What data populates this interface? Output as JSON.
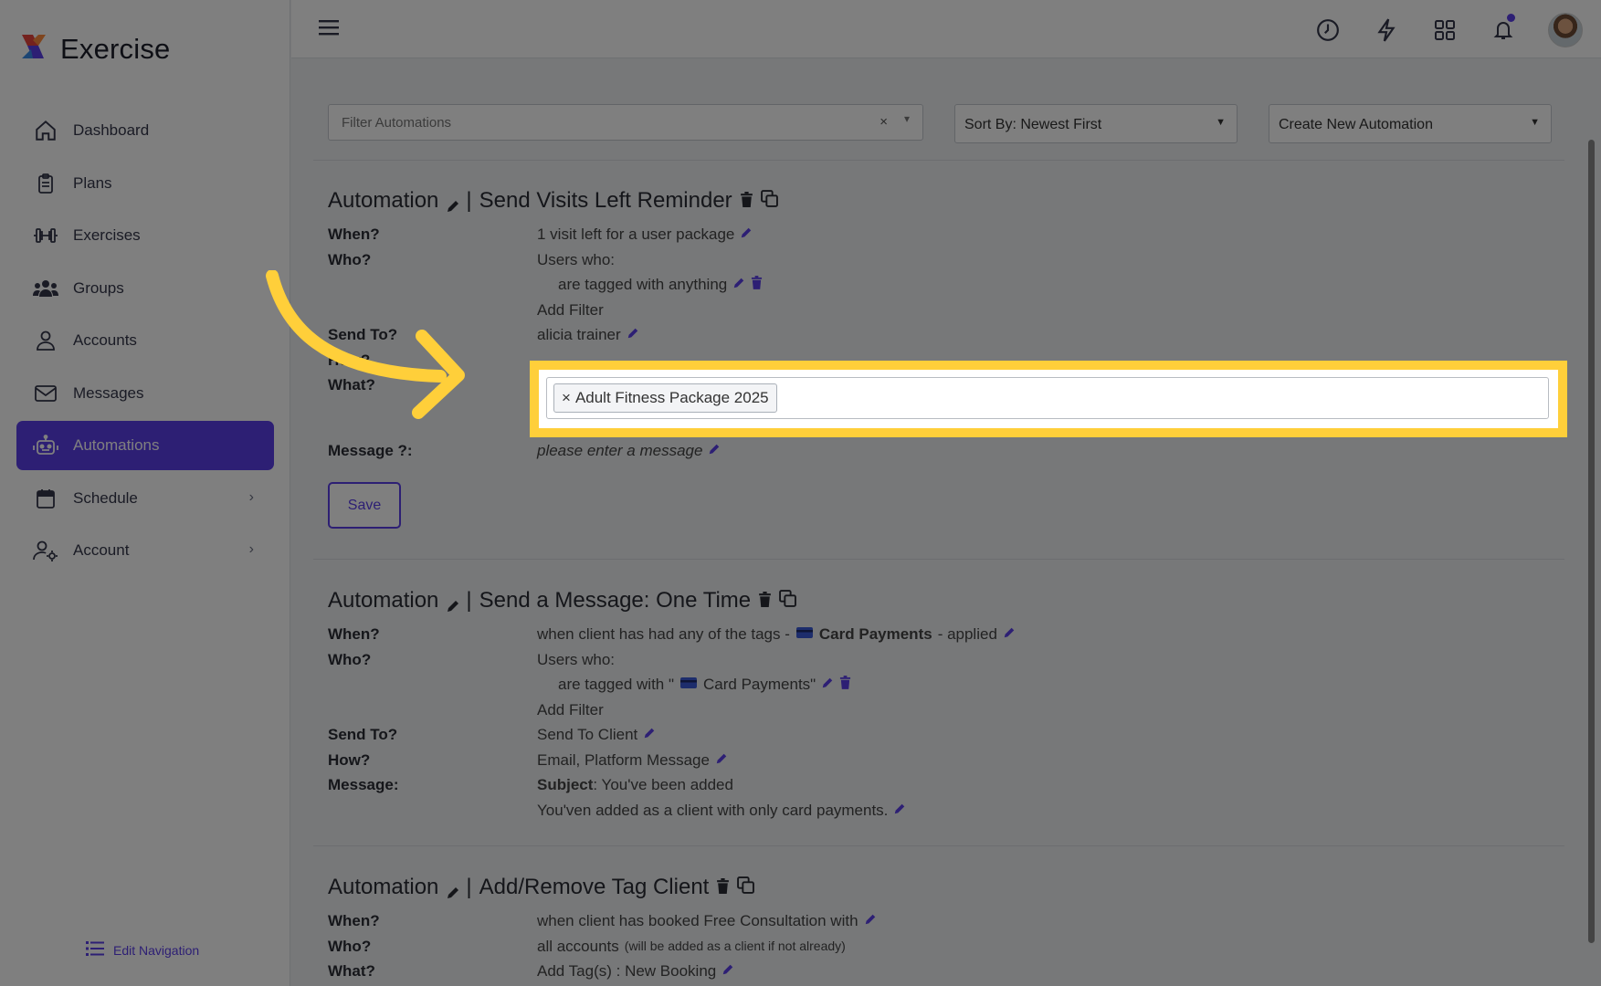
{
  "brand": {
    "name": "Exercise"
  },
  "nav": {
    "items": [
      {
        "label": "Dashboard",
        "icon": "home-icon"
      },
      {
        "label": "Plans",
        "icon": "clipboard-icon"
      },
      {
        "label": "Exercises",
        "icon": "dumbbell-icon"
      },
      {
        "label": "Groups",
        "icon": "users-icon"
      },
      {
        "label": "Accounts",
        "icon": "user-icon"
      },
      {
        "label": "Messages",
        "icon": "envelope-icon"
      },
      {
        "label": "Automations",
        "icon": "robot-icon",
        "active": true
      },
      {
        "label": "Schedule",
        "icon": "calendar-icon",
        "chevron": true
      },
      {
        "label": "Account",
        "icon": "user-gear-icon",
        "chevron": true
      }
    ],
    "edit_label": "Edit Navigation"
  },
  "topbar": {
    "icons": [
      "clock-icon",
      "bolt-icon",
      "grid-icon",
      "bell-icon",
      "avatar"
    ]
  },
  "filters": {
    "filter_placeholder": "Filter Automations",
    "filter_clear": "×",
    "sort_label": "Sort By: Newest First",
    "create_label": "Create New Automation"
  },
  "automations": [
    {
      "prefix": "Automation",
      "title": "Send Visits Left Reminder",
      "when": "1 visit left for a user package",
      "who": "Users who:",
      "who_detail": "are tagged with anything",
      "add_filter": "Add Filter",
      "send_to": "alicia trainer",
      "what_tag": "Adult Fitness Package 2025",
      "message": "please enter a message",
      "save": "Save"
    },
    {
      "prefix": "Automation",
      "title": "Send a Message: One Time",
      "when_pre": "when client has had any of the tags -",
      "when_tag": "Card Payments",
      "when_post": "- applied",
      "who": "Users who:",
      "who_detail": "are tagged with \"",
      "who_tag": "Card Payments\"",
      "add_filter": "Add Filter",
      "send_to": "Send To Client",
      "how": "Email, Platform Message",
      "subject_label": "Subject",
      "subject": ": You've been added",
      "body": "You'ven added as a client with only card payments."
    },
    {
      "prefix": "Automation",
      "title": "Add/Remove Tag Client",
      "when": "when client has booked Free Consultation with",
      "who": "all accounts",
      "who_note": "(will be added as a client if not already)",
      "what": "Add Tag(s) : New Booking"
    }
  ],
  "labels": {
    "when": "When?",
    "who": "Who?",
    "send_to": "Send To?",
    "how": "How?",
    "what": "What?",
    "message_q": "Message ?:",
    "message": "Message:",
    "separator": "|"
  },
  "colors": {
    "accent": "#5b3ee9",
    "highlight": "#ffcf3a"
  }
}
